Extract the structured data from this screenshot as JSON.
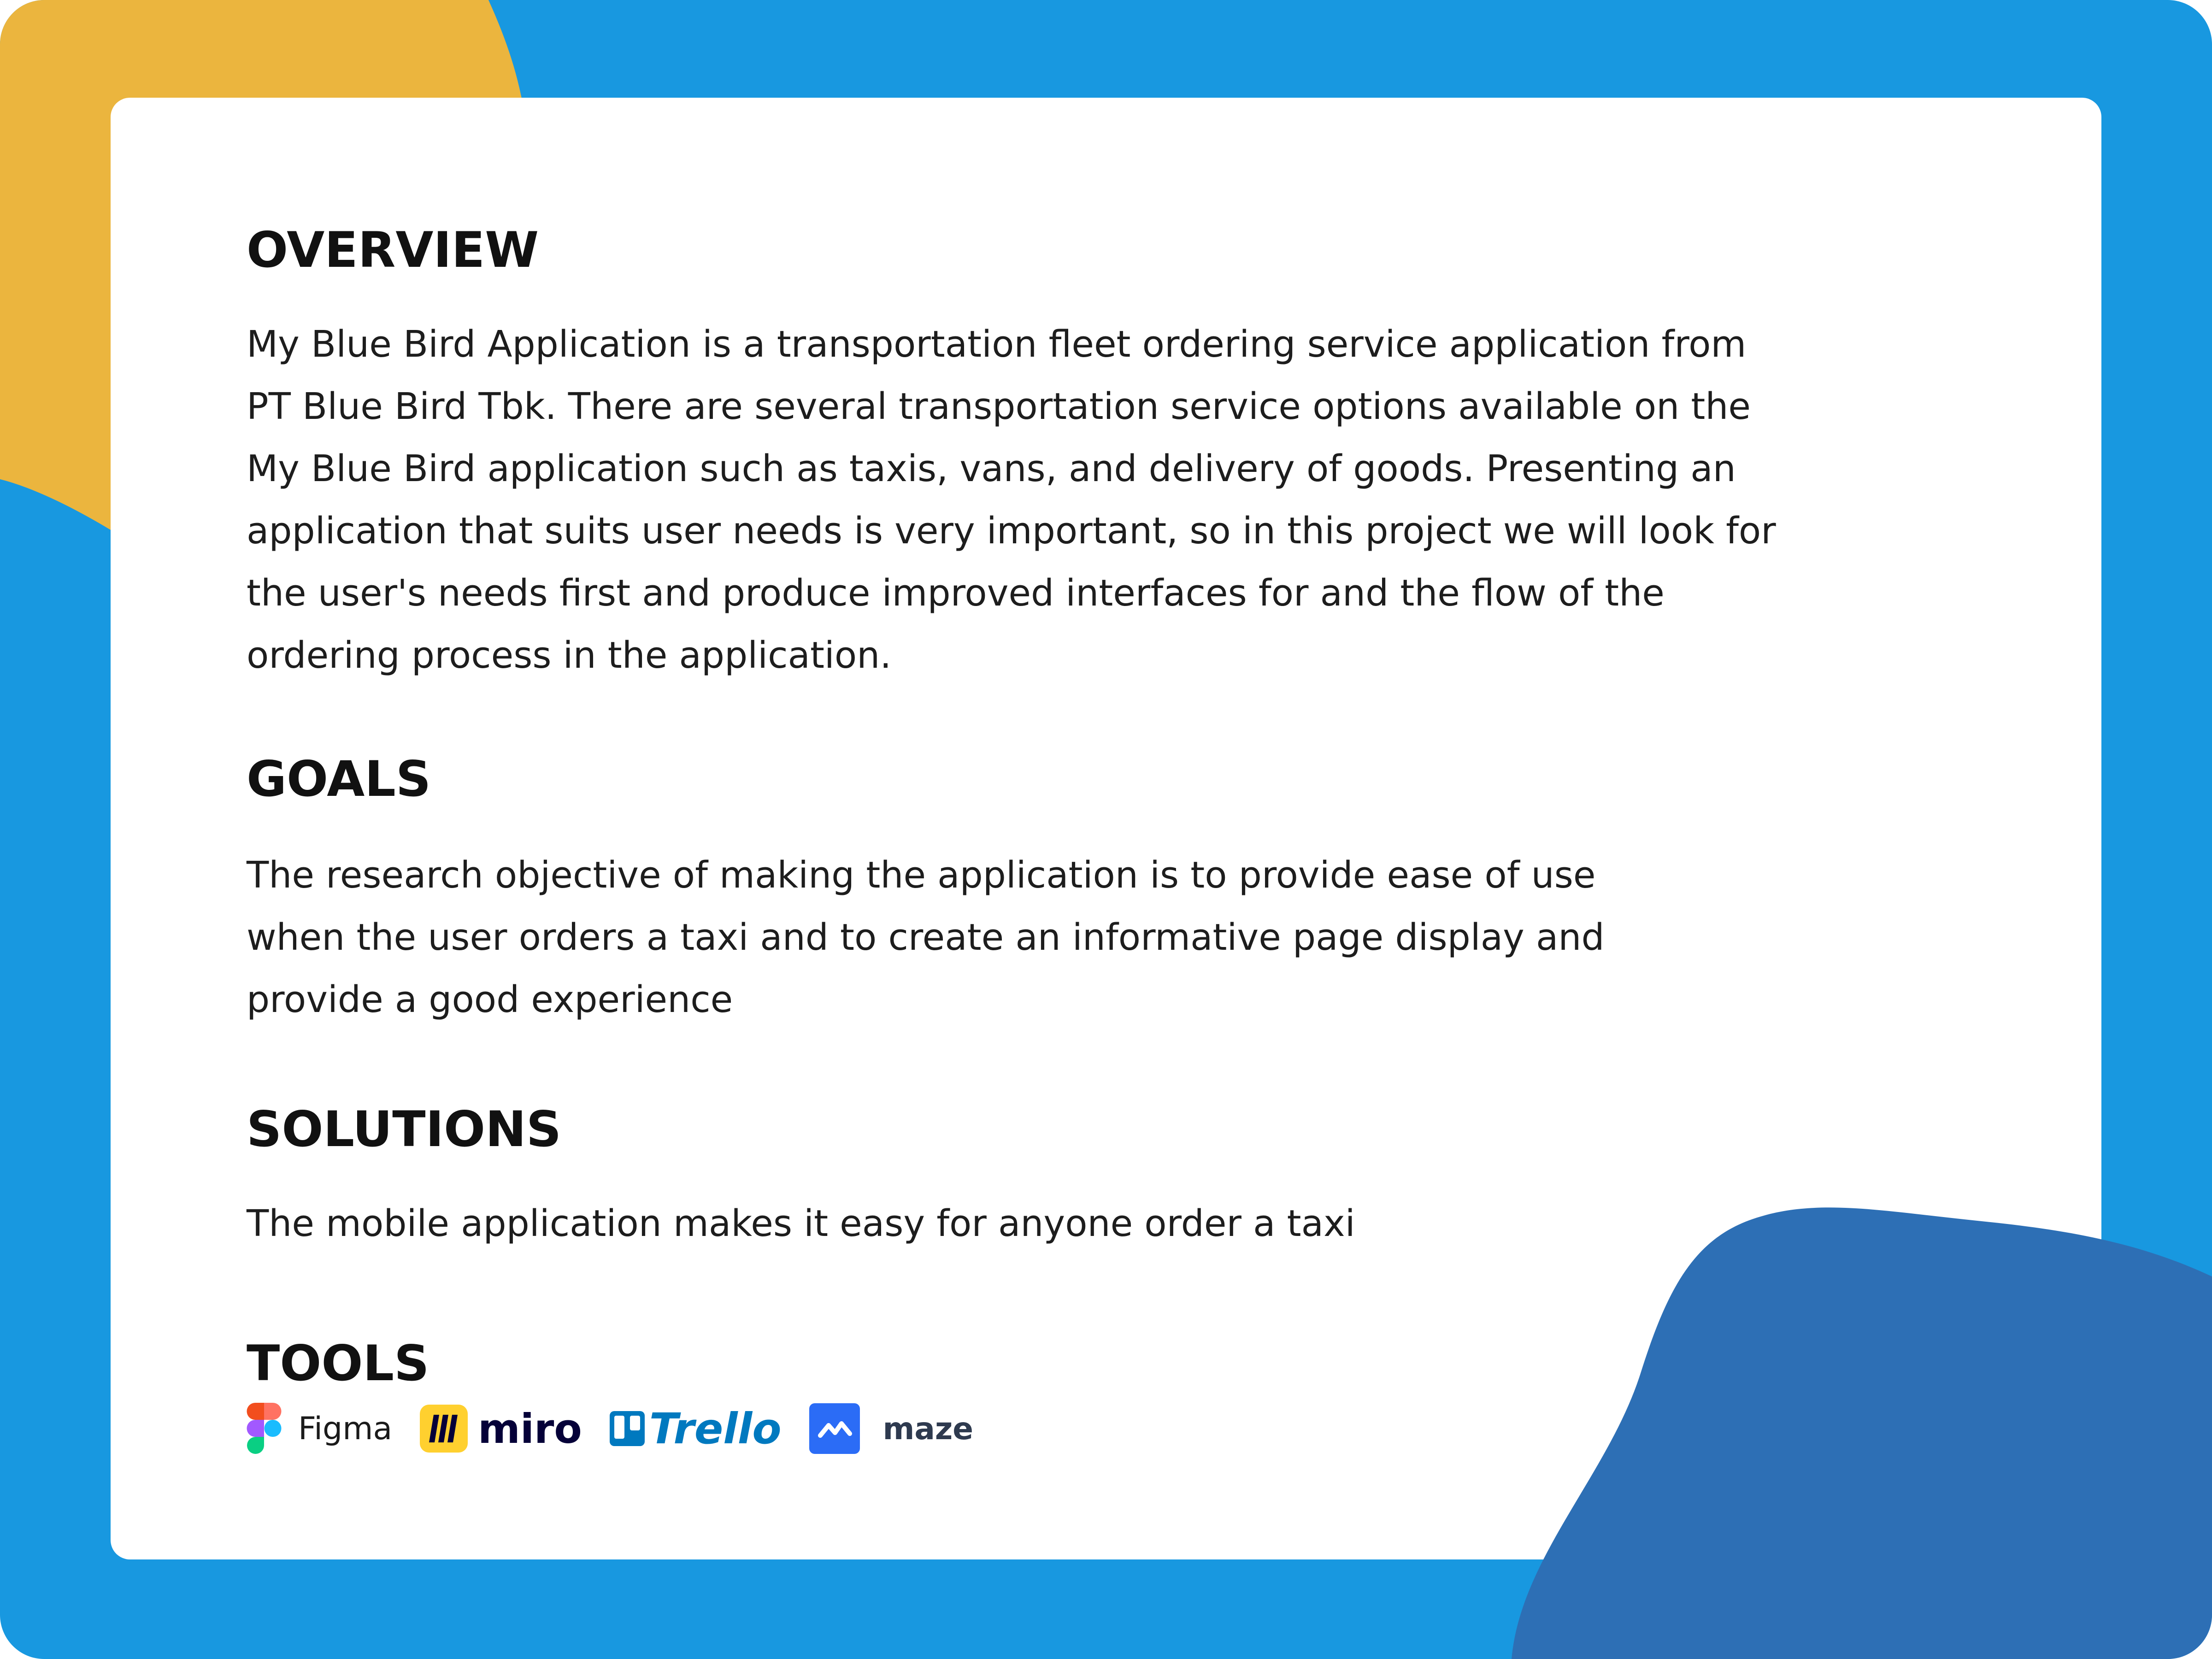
{
  "colors": {
    "background": "#1898e0",
    "top_left_blob": "#ebb53e",
    "bottom_right_blob": "#2d6fb5",
    "card": "#ffffff",
    "heading": "#111111",
    "body_text": "#1d1d1d"
  },
  "overview": {
    "heading": "OVERVIEW",
    "lines": [
      "My Blue Bird Application is a transportation fleet ordering service application from",
      "PT Blue Bird Tbk. There are several transportation service options available on the",
      "My Blue Bird application such as taxis, vans, and delivery of goods. Presenting an",
      "application that suits user needs is very important, so in this project we will look for",
      "the user's needs first and produce improved interfaces for and the flow of the",
      "ordering process in the application."
    ]
  },
  "goals": {
    "heading": "GOALS",
    "lines": [
      "The research objective of making the application is to provide ease of use",
      "when the user orders a taxi and to create an informative page display and",
      "provide a good experience"
    ]
  },
  "solutions": {
    "heading": "SOLUTIONS",
    "lines": [
      "The mobile application makes it easy for anyone order a taxi"
    ]
  },
  "tools": {
    "heading": "TOOLS",
    "items": [
      {
        "label": "Figma",
        "icon": "figma-logo-icon"
      },
      {
        "label": "miro",
        "icon": "miro-logo-icon"
      },
      {
        "label": "Trello",
        "icon": "trello-logo-icon"
      },
      {
        "label": "maze",
        "icon": "maze-logo-icon"
      }
    ]
  }
}
